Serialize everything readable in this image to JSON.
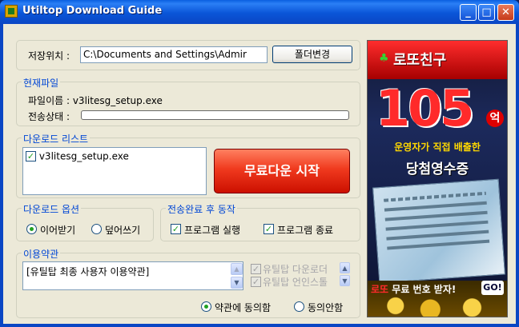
{
  "window": {
    "title": "Utiltop Download Guide"
  },
  "save_location": {
    "label": "저장위치 :",
    "path": "C:\\Documents and Settings\\Admir",
    "change_folder_label": "폴더변경"
  },
  "current_file": {
    "legend": "현재파일",
    "filename_label": "파일이름 : v3litesg_setup.exe",
    "transfer_label": "전송상태 :",
    "progress": 0
  },
  "download_list": {
    "legend": "다운로드 리스트",
    "items": [
      {
        "name": "v3litesg_setup.exe",
        "checked": true
      }
    ],
    "start_label": "무료다운 시작"
  },
  "download_options": {
    "legend": "다운로드 옵션",
    "resume_label": "이어받기",
    "overwrite_label": "덮어쓰기",
    "selected": "resume"
  },
  "after_transfer": {
    "legend": "전송완료 후 동작",
    "run_program_label": "프로그램 실행",
    "exit_program_label": "프로그램 종료"
  },
  "terms": {
    "legend": "이용약관",
    "text": "[유틸탑 최종 사용자 이용약관]",
    "downloader_label": "유틸탑 다운로더",
    "uninstall_label": "유틸탑 언인스톨",
    "agree_label": "약관에 동의함",
    "disagree_label": "동의안함",
    "selected": "agree"
  },
  "ad": {
    "brand": "로또친구",
    "amount": "105",
    "unit": "억",
    "line1": "운영자가 직접 배출한",
    "line2": "당첨영수증",
    "cta_red": "로또",
    "cta_white": "무료 번호 받자!",
    "go": "GO!"
  }
}
